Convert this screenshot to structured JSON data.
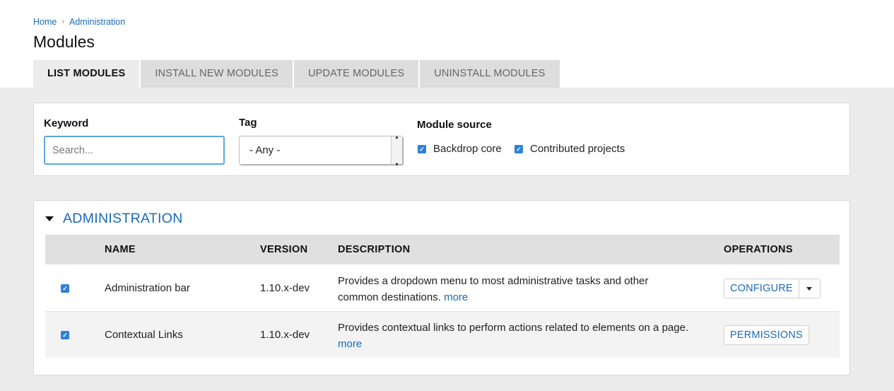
{
  "breadcrumb": {
    "items": [
      "Home",
      "Administration"
    ]
  },
  "page": {
    "title": "Modules"
  },
  "tabs": [
    {
      "label": "LIST MODULES",
      "active": true
    },
    {
      "label": "INSTALL NEW MODULES",
      "active": false
    },
    {
      "label": "UPDATE MODULES",
      "active": false
    },
    {
      "label": "UNINSTALL MODULES",
      "active": false
    }
  ],
  "filters": {
    "keyword_label": "Keyword",
    "keyword_placeholder": "Search...",
    "keyword_value": "",
    "tag_label": "Tag",
    "tag_selected": "- Any -",
    "source_label": "Module source",
    "sources": [
      {
        "label": "Backdrop core",
        "checked": true
      },
      {
        "label": "Contributed projects",
        "checked": true
      }
    ]
  },
  "group": {
    "title": "ADMINISTRATION",
    "columns": [
      "NAME",
      "VERSION",
      "DESCRIPTION",
      "OPERATIONS"
    ],
    "rows": [
      {
        "checked": true,
        "name": "Administration bar",
        "version": "1.10.x-dev",
        "description": "Provides a dropdown menu to most administrative tasks and other common destinations.",
        "more": "more",
        "operation": "CONFIGURE"
      },
      {
        "checked": true,
        "name": "Contextual Links",
        "version": "1.10.x-dev",
        "description": "Provides contextual links to perform actions related to elements on a page.",
        "more": "more",
        "operation": "PERMISSIONS"
      }
    ]
  },
  "colors": {
    "link": "#1a6ab8",
    "checkbox": "#2f80d8",
    "focus_border": "#5aa9e0"
  }
}
